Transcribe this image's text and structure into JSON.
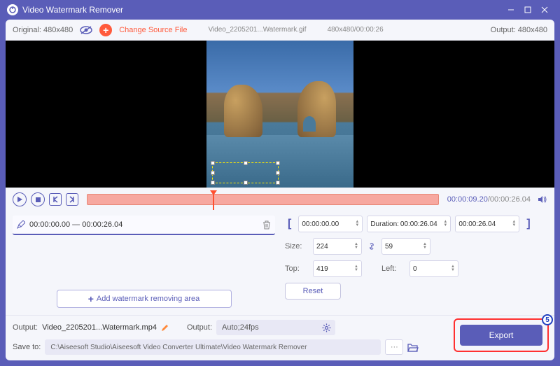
{
  "window": {
    "title": "Video Watermark Remover"
  },
  "topbar": {
    "original": "Original: 480x480",
    "change_source": "Change Source File",
    "filename": "Video_2205201...Watermark.gif",
    "meta": "480x480/00:00:26",
    "output": "Output: 480x480"
  },
  "transport": {
    "current": "00:00:09.20",
    "total": "/00:00:26.04"
  },
  "clip": {
    "range": "00:00:00.00 — 00:00:26.04"
  },
  "range": {
    "start": "00:00:00.00",
    "duration_label": "Duration:",
    "duration": "00:00:26.04",
    "end": "00:00:26.04"
  },
  "size": {
    "label": "Size:",
    "w": "224",
    "h": "59"
  },
  "pos": {
    "top_label": "Top:",
    "top": "419",
    "left_label": "Left:",
    "left": "0"
  },
  "buttons": {
    "reset": "Reset",
    "add_area": "Add watermark removing area",
    "export": "Export"
  },
  "output": {
    "label": "Output:",
    "filename": "Video_2205201...Watermark.mp4",
    "format_label": "Output:",
    "format": "Auto;24fps",
    "save_label": "Save to:",
    "save_path": "C:\\Aiseesoft Studio\\Aiseesoft Video Converter Ultimate\\Video Watermark Remover"
  },
  "badge": "5"
}
